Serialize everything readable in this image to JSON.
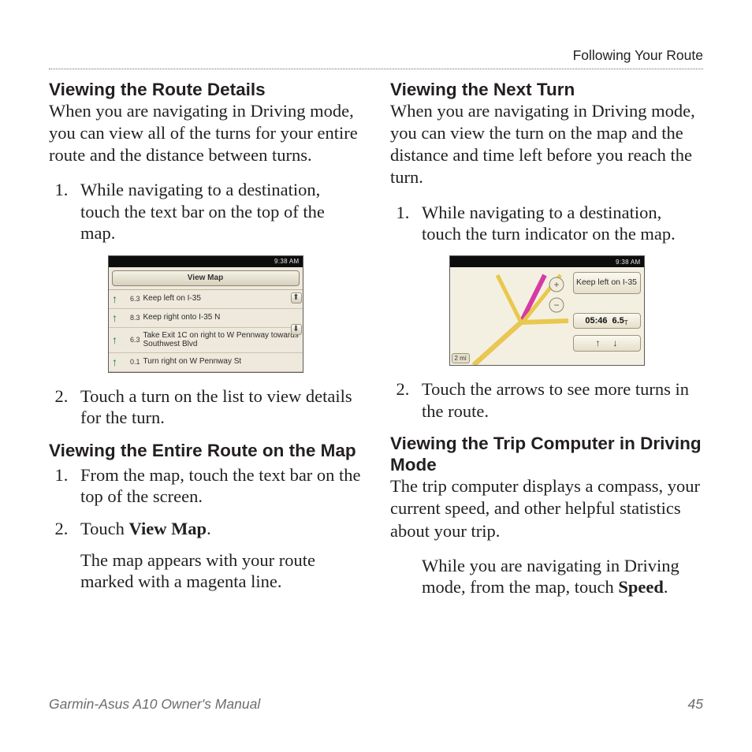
{
  "running_head": "Following Your Route",
  "footer": {
    "left": "Garmin-Asus A10 Owner's Manual",
    "right": "45"
  },
  "left": {
    "h1": "Viewing the Route Details",
    "p1": "When you are navigating in Driving mode, you can view all of the turns for your entire route and the distance between turns.",
    "step1": "While navigating to a destination, touch the text bar on the top of the map.",
    "step2": "Touch a turn on the list to view details for the turn.",
    "h2": "Viewing the Entire Route on the Map",
    "s2step1": "From the map, touch the text bar on the top of the screen.",
    "s2step2a": "Touch ",
    "s2step2b": "View Map",
    "s2step2c": ".",
    "s2after": "The map appears with your route marked with a magenta line."
  },
  "right": {
    "h1": "Viewing the Next Turn",
    "p1": "When you are navigating in Driving mode, you can view the turn on the map and the distance and time left before you reach the turn.",
    "step1": "While navigating to a destination, touch the turn indicator on the map.",
    "step2": "Touch the arrows to see more turns in the route.",
    "h2": "Viewing the Trip Computer in Driving Mode",
    "p2": "The trip computer displays a compass, your current speed, and other helpful statistics about your trip.",
    "inda": "While you are navigating in Driving mode, from the map, touch ",
    "indb": "Speed",
    "indc": "."
  },
  "shot_status": {
    "left": "",
    "right": "9:38 AM"
  },
  "shot1": {
    "button": "View Map",
    "rows": [
      {
        "dist": "6.3",
        "unit": "",
        "text": "Keep left on I-35"
      },
      {
        "dist": "8.3",
        "unit": "",
        "text": "Keep right onto I-35 N"
      },
      {
        "dist": "6.3",
        "unit": "",
        "text": "Take Exit 1C on right to W Pennway towards Southwest Blvd"
      },
      {
        "dist": "0.1",
        "unit": "",
        "text": "Turn right on W Pennway St"
      }
    ]
  },
  "shot2": {
    "info": "Keep left on I-35",
    "time": "05:46",
    "dist": "6.5",
    "dist_unit": "T",
    "zoom": "2 mi"
  }
}
